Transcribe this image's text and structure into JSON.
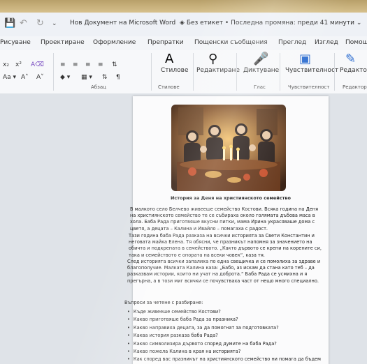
{
  "window": {
    "title": "Нов Документ на Microsoft Word",
    "label_status": "Без етикет",
    "last_change": "Последна промяна: преди 41 минути"
  },
  "menu": [
    "Рисуване",
    "Проектиране",
    "Оформление",
    "Препратки",
    "Пощенски съобщения",
    "Преглед",
    "Изглед",
    "Помощ"
  ],
  "ribbon": {
    "styles": "Стилове",
    "editing": "Редактиране",
    "dictate": "Диктуване",
    "sensitivity": "Чувствителност",
    "editor": "Редактор",
    "group_paragraph": "Абзац",
    "group_styles": "Стилове",
    "group_voice": "Глас",
    "group_sensitivity": "Чувствителност",
    "group_editor": "Редактор"
  },
  "doc": {
    "caption": "История за Деня на християнското семейство",
    "paragraphs": [
      "В малкото село Белчево живееше семейство Костови. Всяка година на Деня на християнското семейство те се събираха около голямата дъбова маса в хола. Баба Рада приготвяше вкусни питки, мама Ирина украсяваше дома с цветя, а децата – Калина и Ивайло – помагаха с радост.",
      "Тази година баба Рада разказа на всички историята за Свети Константин и неговата майка Елена. Тя обясни, че празникът напомня за значението на обичта и подкрепата в семейството. „Както дървото се крепи на корените си, така и семейството е опората на всеки човек“, каза тя.",
      "След историята всички запалиха по една свещичка и се помолиха за здраве и благополучие. Малката Калина каза: „Бабо, аз искам да стана като теб – да разказвам истории, които ни учат на доброта.“ Баба Рада се усмихна и я прегърна, а в този миг всички се почувстваха част от нещо много специално."
    ],
    "questions_title": "Въпроси за четене с разбиране:",
    "questions": [
      "Къде живееше семейство Костови?",
      "Какво приготвяше баба Рада за празника?",
      "Какво направиха децата, за да помогнат за подготовката?",
      "Каква история разказа баба Рада?",
      "Какво символизира дървото според думите на баба Рада?",
      "Какво пожела Калина в края на историята?",
      "Как според вас празникът на християнското семейство ни помага да бъдем"
    ]
  }
}
